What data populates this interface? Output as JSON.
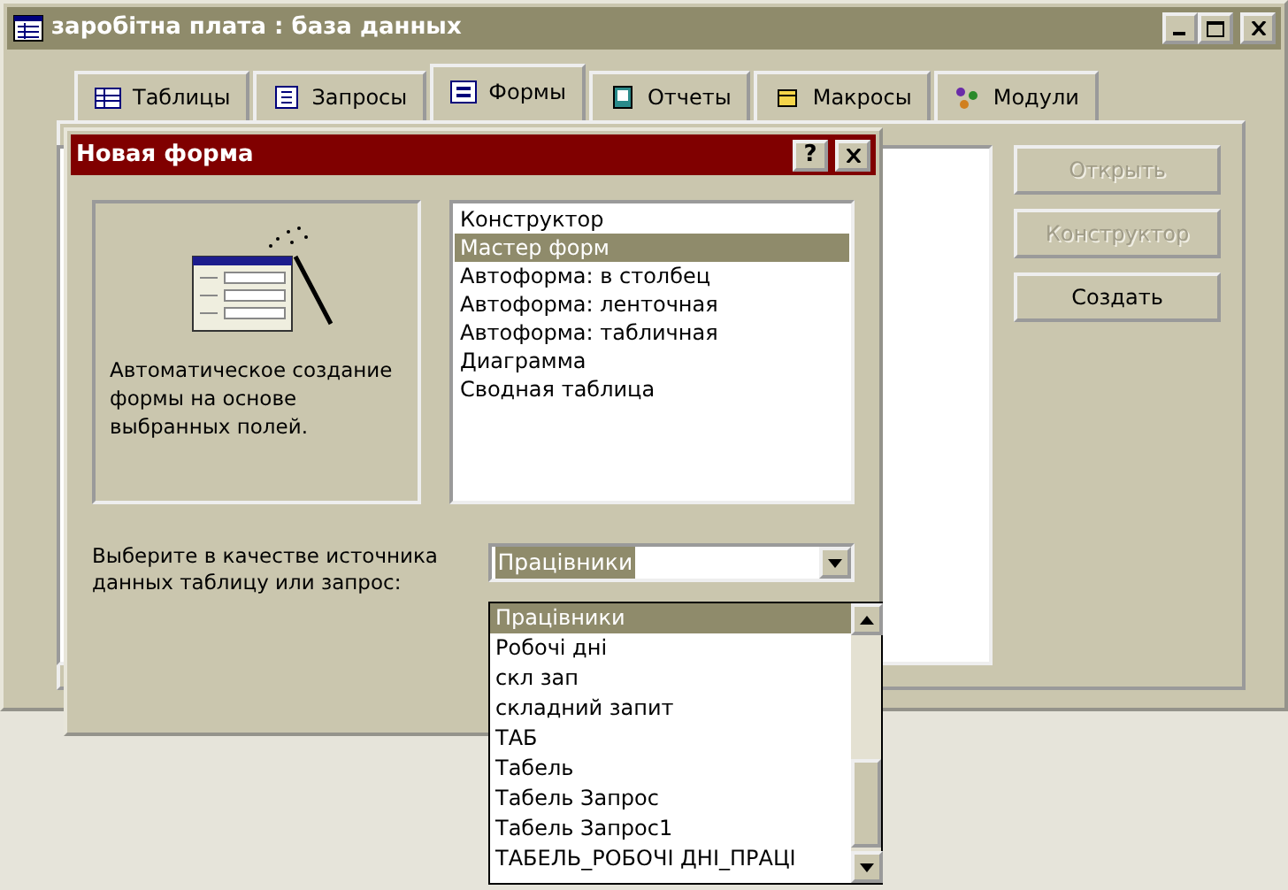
{
  "window": {
    "title": "заробітна плата : база данных"
  },
  "tabs": [
    {
      "label": "Таблицы",
      "selected": false
    },
    {
      "label": "Запросы",
      "selected": false
    },
    {
      "label": "Формы",
      "selected": true
    },
    {
      "label": "Отчеты",
      "selected": false
    },
    {
      "label": "Макросы",
      "selected": false
    },
    {
      "label": "Модули",
      "selected": false
    }
  ],
  "buttons": [
    {
      "label": "Открыть",
      "disabled": true
    },
    {
      "label": "Конструктор",
      "disabled": true
    },
    {
      "label": "Создать",
      "disabled": false
    }
  ],
  "dialog": {
    "title": "Новая форма",
    "help": "?",
    "description": "Автоматическое создание формы на основе выбранных полей.",
    "options": [
      {
        "label": "Конструктор",
        "selected": false
      },
      {
        "label": "Мастер форм",
        "selected": true
      },
      {
        "label": "Автоформа: в столбец",
        "selected": false
      },
      {
        "label": "Автоформа: ленточная",
        "selected": false
      },
      {
        "label": "Автоформа: табличная",
        "selected": false
      },
      {
        "label": "Диаграмма",
        "selected": false
      },
      {
        "label": "Сводная таблица",
        "selected": false
      }
    ],
    "source_label": "Выберите в качестве источника данных таблицу или запрос:",
    "source_value": "Працівники",
    "source_options": [
      {
        "label": "Працівники",
        "selected": true
      },
      {
        "label": "Робочі дні",
        "selected": false
      },
      {
        "label": "скл зап",
        "selected": false
      },
      {
        "label": "складний запит",
        "selected": false
      },
      {
        "label": "ТАБ",
        "selected": false
      },
      {
        "label": "Табель",
        "selected": false
      },
      {
        "label": "Табель Запрос",
        "selected": false
      },
      {
        "label": "Табель Запрос1",
        "selected": false
      },
      {
        "label": "ТАБЕЛЬ_РОБОЧІ ДНІ_ПРАЦІ",
        "selected": false
      }
    ]
  }
}
